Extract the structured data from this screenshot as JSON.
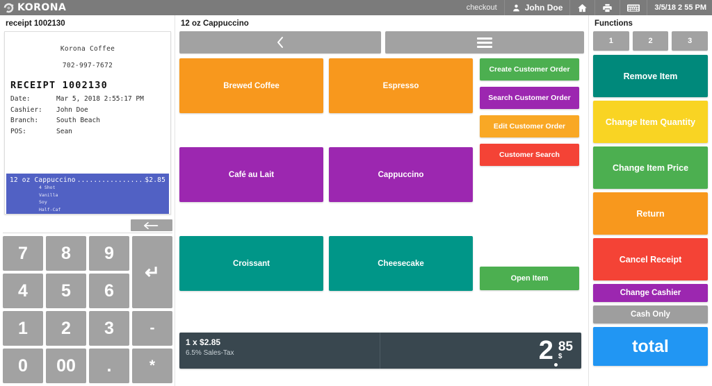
{
  "topbar": {
    "brand": "KORONA",
    "brand_icon": "korona-swirl-logo",
    "checkout_label": "checkout",
    "user_icon": "user-icon",
    "user_name": "John Doe",
    "home_icon": "home-icon",
    "print_icon": "printer-icon",
    "keyboard_icon": "keyboard-icon",
    "datetime": "3/5/18 2 55 PM",
    "bg_color": "#7b7b7b"
  },
  "receipt_panel": {
    "title": "receipt 1002130",
    "store_name": "Korona Coffee",
    "phone": "702-997-7672",
    "heading": "RECEIPT 1002130",
    "meta": [
      {
        "key": "Date:",
        "value": "Mar 5, 2018 2:55:17 PM"
      },
      {
        "key": "Cashier:",
        "value": "John Doe"
      },
      {
        "key": "Branch:",
        "value": "South Beach"
      },
      {
        "key": "POS:",
        "value": "Sean"
      }
    ],
    "selected_line": {
      "name": "12 oz Cappuccino",
      "dots": ".................",
      "price": "$2.85",
      "highlight_color": "#5161c4",
      "modifiers": [
        "4 Shot",
        "Vanilla",
        "Soy",
        "Half-Caf"
      ]
    }
  },
  "keypad": {
    "backspace_icon": "arrow-left-icon",
    "keys": [
      {
        "label": "7",
        "name": "key-7"
      },
      {
        "label": "8",
        "name": "key-8"
      },
      {
        "label": "9",
        "name": "key-9"
      },
      {
        "label": "↵",
        "name": "key-enter"
      },
      {
        "label": "4",
        "name": "key-4"
      },
      {
        "label": "5",
        "name": "key-5"
      },
      {
        "label": "6",
        "name": "key-6"
      },
      {
        "label": "1",
        "name": "key-1"
      },
      {
        "label": "2",
        "name": "key-2"
      },
      {
        "label": "3",
        "name": "key-3"
      },
      {
        "label": "-",
        "name": "key-minus"
      },
      {
        "label": "0",
        "name": "key-0"
      },
      {
        "label": "00",
        "name": "key-double-zero"
      },
      {
        "label": ".",
        "name": "key-decimal"
      },
      {
        "label": "*",
        "name": "key-asterisk"
      }
    ]
  },
  "center": {
    "title": "12 oz Cappuccino",
    "back_icon": "chevron-left-icon",
    "menu_icon": "hamburger-menu-icon",
    "products": [
      {
        "label": "Brewed Coffee",
        "color": "#f8981d"
      },
      {
        "label": "Espresso",
        "color": "#f8981d"
      },
      {
        "label": "Café au Lait",
        "color": "#9c27b0"
      },
      {
        "label": "Cappuccino",
        "color": "#9c27b0"
      },
      {
        "label": "Croissant",
        "color": "#009688"
      },
      {
        "label": "Cheesecake",
        "color": "#009688"
      }
    ],
    "customer_actions": [
      {
        "label": "Create Customer Order",
        "color": "#4caf50"
      },
      {
        "label": "Search Customer Order",
        "color": "#9c27b0"
      },
      {
        "label": "Edit Customer Order",
        "color": "#f9a825"
      },
      {
        "label": "Customer Search",
        "color": "#f44336"
      }
    ],
    "open_item": {
      "label": "Open Item",
      "color": "#4caf50"
    }
  },
  "total_bar": {
    "quantity_line": "1 x $2.85",
    "tax_line": "6.5% Sales-Tax",
    "price_integer": "2",
    "price_decimal": "85",
    "currency": "$",
    "bg_color": "#39474f"
  },
  "functions": {
    "title": "Functions",
    "tabs": [
      {
        "label": "1"
      },
      {
        "label": "2"
      },
      {
        "label": "3"
      }
    ],
    "buttons": [
      {
        "label": "Remove Item",
        "color": "#00897b",
        "size": "tall"
      },
      {
        "label": "Change Item Quantity",
        "color": "#f9d423",
        "size": "tall"
      },
      {
        "label": "Change Item Price",
        "color": "#4caf50",
        "size": "tall"
      },
      {
        "label": "Return",
        "color": "#f8981d",
        "size": "tall"
      },
      {
        "label": "Cancel Receipt",
        "color": "#f44336",
        "size": "tall"
      },
      {
        "label": "Change Cashier",
        "color": "#9c27b0",
        "size": "short"
      },
      {
        "label": "Cash Only",
        "color": "#9e9e9e",
        "size": "short"
      }
    ],
    "total_button": {
      "label": "total",
      "color": "#2196f3"
    }
  }
}
